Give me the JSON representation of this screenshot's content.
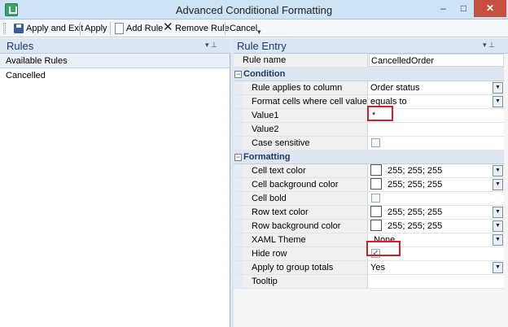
{
  "window": {
    "title": "Advanced Conditional Formatting",
    "min_glyph": "–",
    "max_glyph": "□",
    "close_glyph": "✕"
  },
  "toolbar": {
    "apply_exit_label": "Apply and Exit",
    "apply_label": "Apply",
    "add_rule_label": "Add Rule",
    "remove_rule_label": "Remove Rule",
    "cancel_label": "Cancel",
    "overflow_glyph": "▾"
  },
  "rules_pane": {
    "title": "Rules",
    "pin_glyphs": "▾ ⊥",
    "header": "Available Rules",
    "items": [
      "Cancelled"
    ]
  },
  "entry_pane": {
    "title": "Rule Entry",
    "pin_glyphs": "▾ ⊥"
  },
  "rule_name": {
    "label": "Rule name",
    "value": "CancelledOrder"
  },
  "condition": {
    "title": "Condition",
    "toggle": "−",
    "rows": [
      {
        "label": "Rule applies to column",
        "value": "Order status",
        "dropdown": true
      },
      {
        "label": "Format cells where cell value",
        "value": "equals to",
        "dropdown": true
      },
      {
        "label": "Value1",
        "value": "*"
      },
      {
        "label": "Value2",
        "value": ""
      },
      {
        "label": "Case sensitive",
        "checked": false
      }
    ]
  },
  "formatting": {
    "title": "Formatting",
    "toggle": "−",
    "rows": [
      {
        "label": "Cell text color",
        "value": "255; 255; 255",
        "swatch": "#ffffff",
        "dropdown": true
      },
      {
        "label": "Cell background color",
        "value": "255; 255; 255",
        "swatch": "#ffffff",
        "dropdown": true
      },
      {
        "label": "Cell bold",
        "checked": false
      },
      {
        "label": "Row text color",
        "value": "255; 255; 255",
        "swatch": "#ffffff",
        "dropdown": true
      },
      {
        "label": "Row background color",
        "value": "255; 255; 255",
        "swatch": "#ffffff",
        "dropdown": true
      },
      {
        "label": "XAML Theme",
        "value": "None",
        "dropdown": true
      },
      {
        "label": "Hide row",
        "checked": true
      },
      {
        "label": "Apply to group totals",
        "value": "Yes",
        "dropdown": true
      },
      {
        "label": "Tooltip",
        "value": ""
      }
    ]
  },
  "dropdown_glyph": "▼",
  "check_glyph": "✓",
  "colors": {
    "highlight": "#d21e24",
    "accent": "#1e3b62"
  }
}
